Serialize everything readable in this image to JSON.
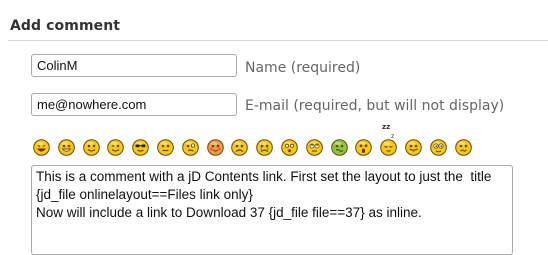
{
  "form": {
    "title": "Add comment",
    "name": {
      "value": "ColinM",
      "label": "Name (required)"
    },
    "email": {
      "value": "me@nowhere.com",
      "label": "E-mail (required, but will not display)"
    },
    "comment": {
      "value": "This is a comment with a jD Contents link. First set the layout to just the  title {jd_file onlinelayout==Files link only}\nNow will include a link to Download 37 {jd_file file==37} as inline."
    }
  },
  "smileys": [
    {
      "icon": "laughing-smiley-icon"
    },
    {
      "icon": "grinning-smiley-icon"
    },
    {
      "icon": "smiling-smiley-icon"
    },
    {
      "icon": "winking-smiley-icon"
    },
    {
      "icon": "cool-smiley-icon"
    },
    {
      "icon": "neutral-smiley-icon"
    },
    {
      "icon": "thinking-smiley-icon"
    },
    {
      "icon": "blushing-smiley-icon"
    },
    {
      "icon": "sad-smiley-icon"
    },
    {
      "icon": "crying-smiley-icon"
    },
    {
      "icon": "surprised-smiley-icon"
    },
    {
      "icon": "rolling-eyes-smiley-icon"
    },
    {
      "icon": "sick-smiley-icon"
    },
    {
      "icon": "shocked-smiley-icon"
    },
    {
      "icon": "sleeping-smiley-icon"
    },
    {
      "icon": "tongue-out-smiley-icon"
    },
    {
      "icon": "big-eyes-smiley-icon"
    },
    {
      "icon": "confused-smiley-icon"
    }
  ],
  "colors": {
    "smiley_face": "#f6c81a",
    "smiley_outline": "#6b4a00",
    "sick_face": "#8cc63f",
    "blush_face": "#f39a4b",
    "field_border": "#aaaaaa",
    "label_text": "#666666"
  }
}
